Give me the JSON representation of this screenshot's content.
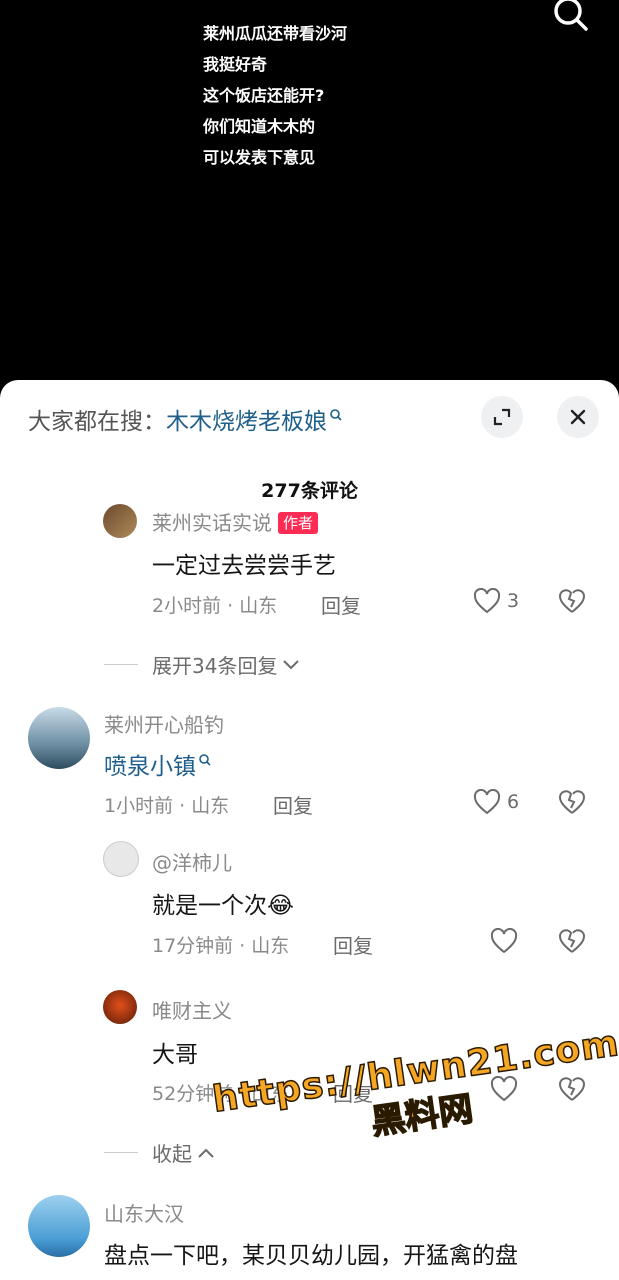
{
  "video": {
    "caption_lines": [
      "莱州瓜瓜还带看沙河",
      "我挺好奇",
      "这个饭店还能开?",
      "你们知道木木的",
      "可以发表下意见"
    ]
  },
  "sheet": {
    "hot_search_prefix": "大家都在搜：",
    "hot_search_keyword": "木木烧烤老板娘",
    "comment_count": "277条评论"
  },
  "comments": [
    {
      "user": "莱州实话实说",
      "tag": "作者",
      "text": "一定过去尝尝手艺",
      "time_loc": "2小时前 · 山东",
      "reply": "回复",
      "likes": "3"
    },
    {
      "expand": "展开34条回复"
    },
    {
      "user": "莱州开心船钓",
      "text": "喷泉小镇",
      "time_loc": "1小时前 · 山东",
      "reply": "回复",
      "likes": "6"
    },
    {
      "user": "@洋柿儿",
      "text": "就是一个次",
      "emoji": "😂",
      "time_loc": "17分钟前 · 山东",
      "reply": "回复",
      "likes": ""
    },
    {
      "user": "唯财主义",
      "text": "大哥",
      "time_loc": "52分钟前 · 山东",
      "reply": "回复",
      "likes": ""
    },
    {
      "collapse": "收起"
    },
    {
      "user": "山东大汉",
      "text": "盘点一下吧，某贝贝幼儿园，开猛禽的盘"
    }
  ],
  "watermark": {
    "line1": "https://hlwn21.com",
    "line2": "黑料网"
  },
  "colors": {
    "accent_red": "#fe2c55",
    "link_blue": "#1f5f8b",
    "watermark_orange": "#f5a623"
  }
}
